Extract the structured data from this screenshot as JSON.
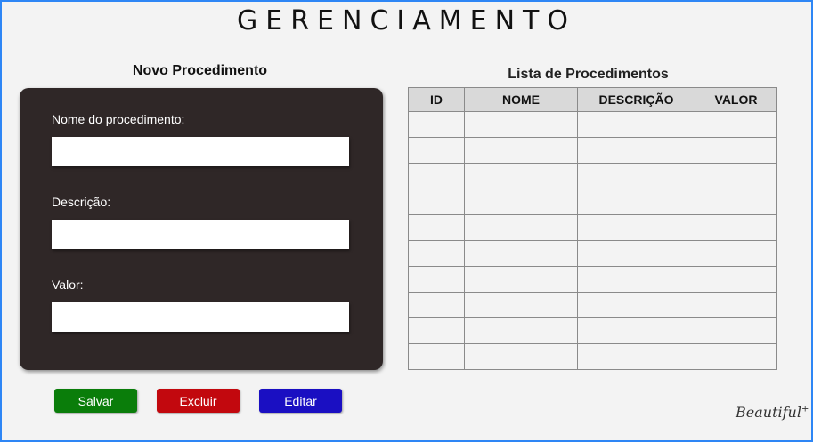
{
  "app": {
    "title": "GERENCIAMENTO"
  },
  "form": {
    "title": "Novo Procedimento",
    "fields": [
      {
        "label": "Nome do procedimento:",
        "value": ""
      },
      {
        "label": "Descrição:",
        "value": ""
      },
      {
        "label": "Valor:",
        "value": ""
      }
    ]
  },
  "buttons": {
    "save": {
      "label": "Salvar",
      "color": "#0a7d0a"
    },
    "delete": {
      "label": "Excluir",
      "color": "#c2080e"
    },
    "edit": {
      "label": "Editar",
      "color": "#1a0fc2"
    }
  },
  "list": {
    "title": "Lista de Procedimentos",
    "columns": [
      "ID",
      "NOME",
      "DESCRIÇÃO",
      "VALOR"
    ],
    "rows": [
      [
        "",
        "",
        "",
        ""
      ],
      [
        "",
        "",
        "",
        ""
      ],
      [
        "",
        "",
        "",
        ""
      ],
      [
        "",
        "",
        "",
        ""
      ],
      [
        "",
        "",
        "",
        ""
      ],
      [
        "",
        "",
        "",
        ""
      ],
      [
        "",
        "",
        "",
        ""
      ],
      [
        "",
        "",
        "",
        ""
      ],
      [
        "",
        "",
        "",
        ""
      ],
      [
        "",
        "",
        "",
        ""
      ]
    ]
  },
  "footer": {
    "signature": "Beautiful"
  },
  "colors": {
    "frame_border": "#2e86f5",
    "card_bg": "#2f2727",
    "header_bg": "#d9d9d9"
  }
}
